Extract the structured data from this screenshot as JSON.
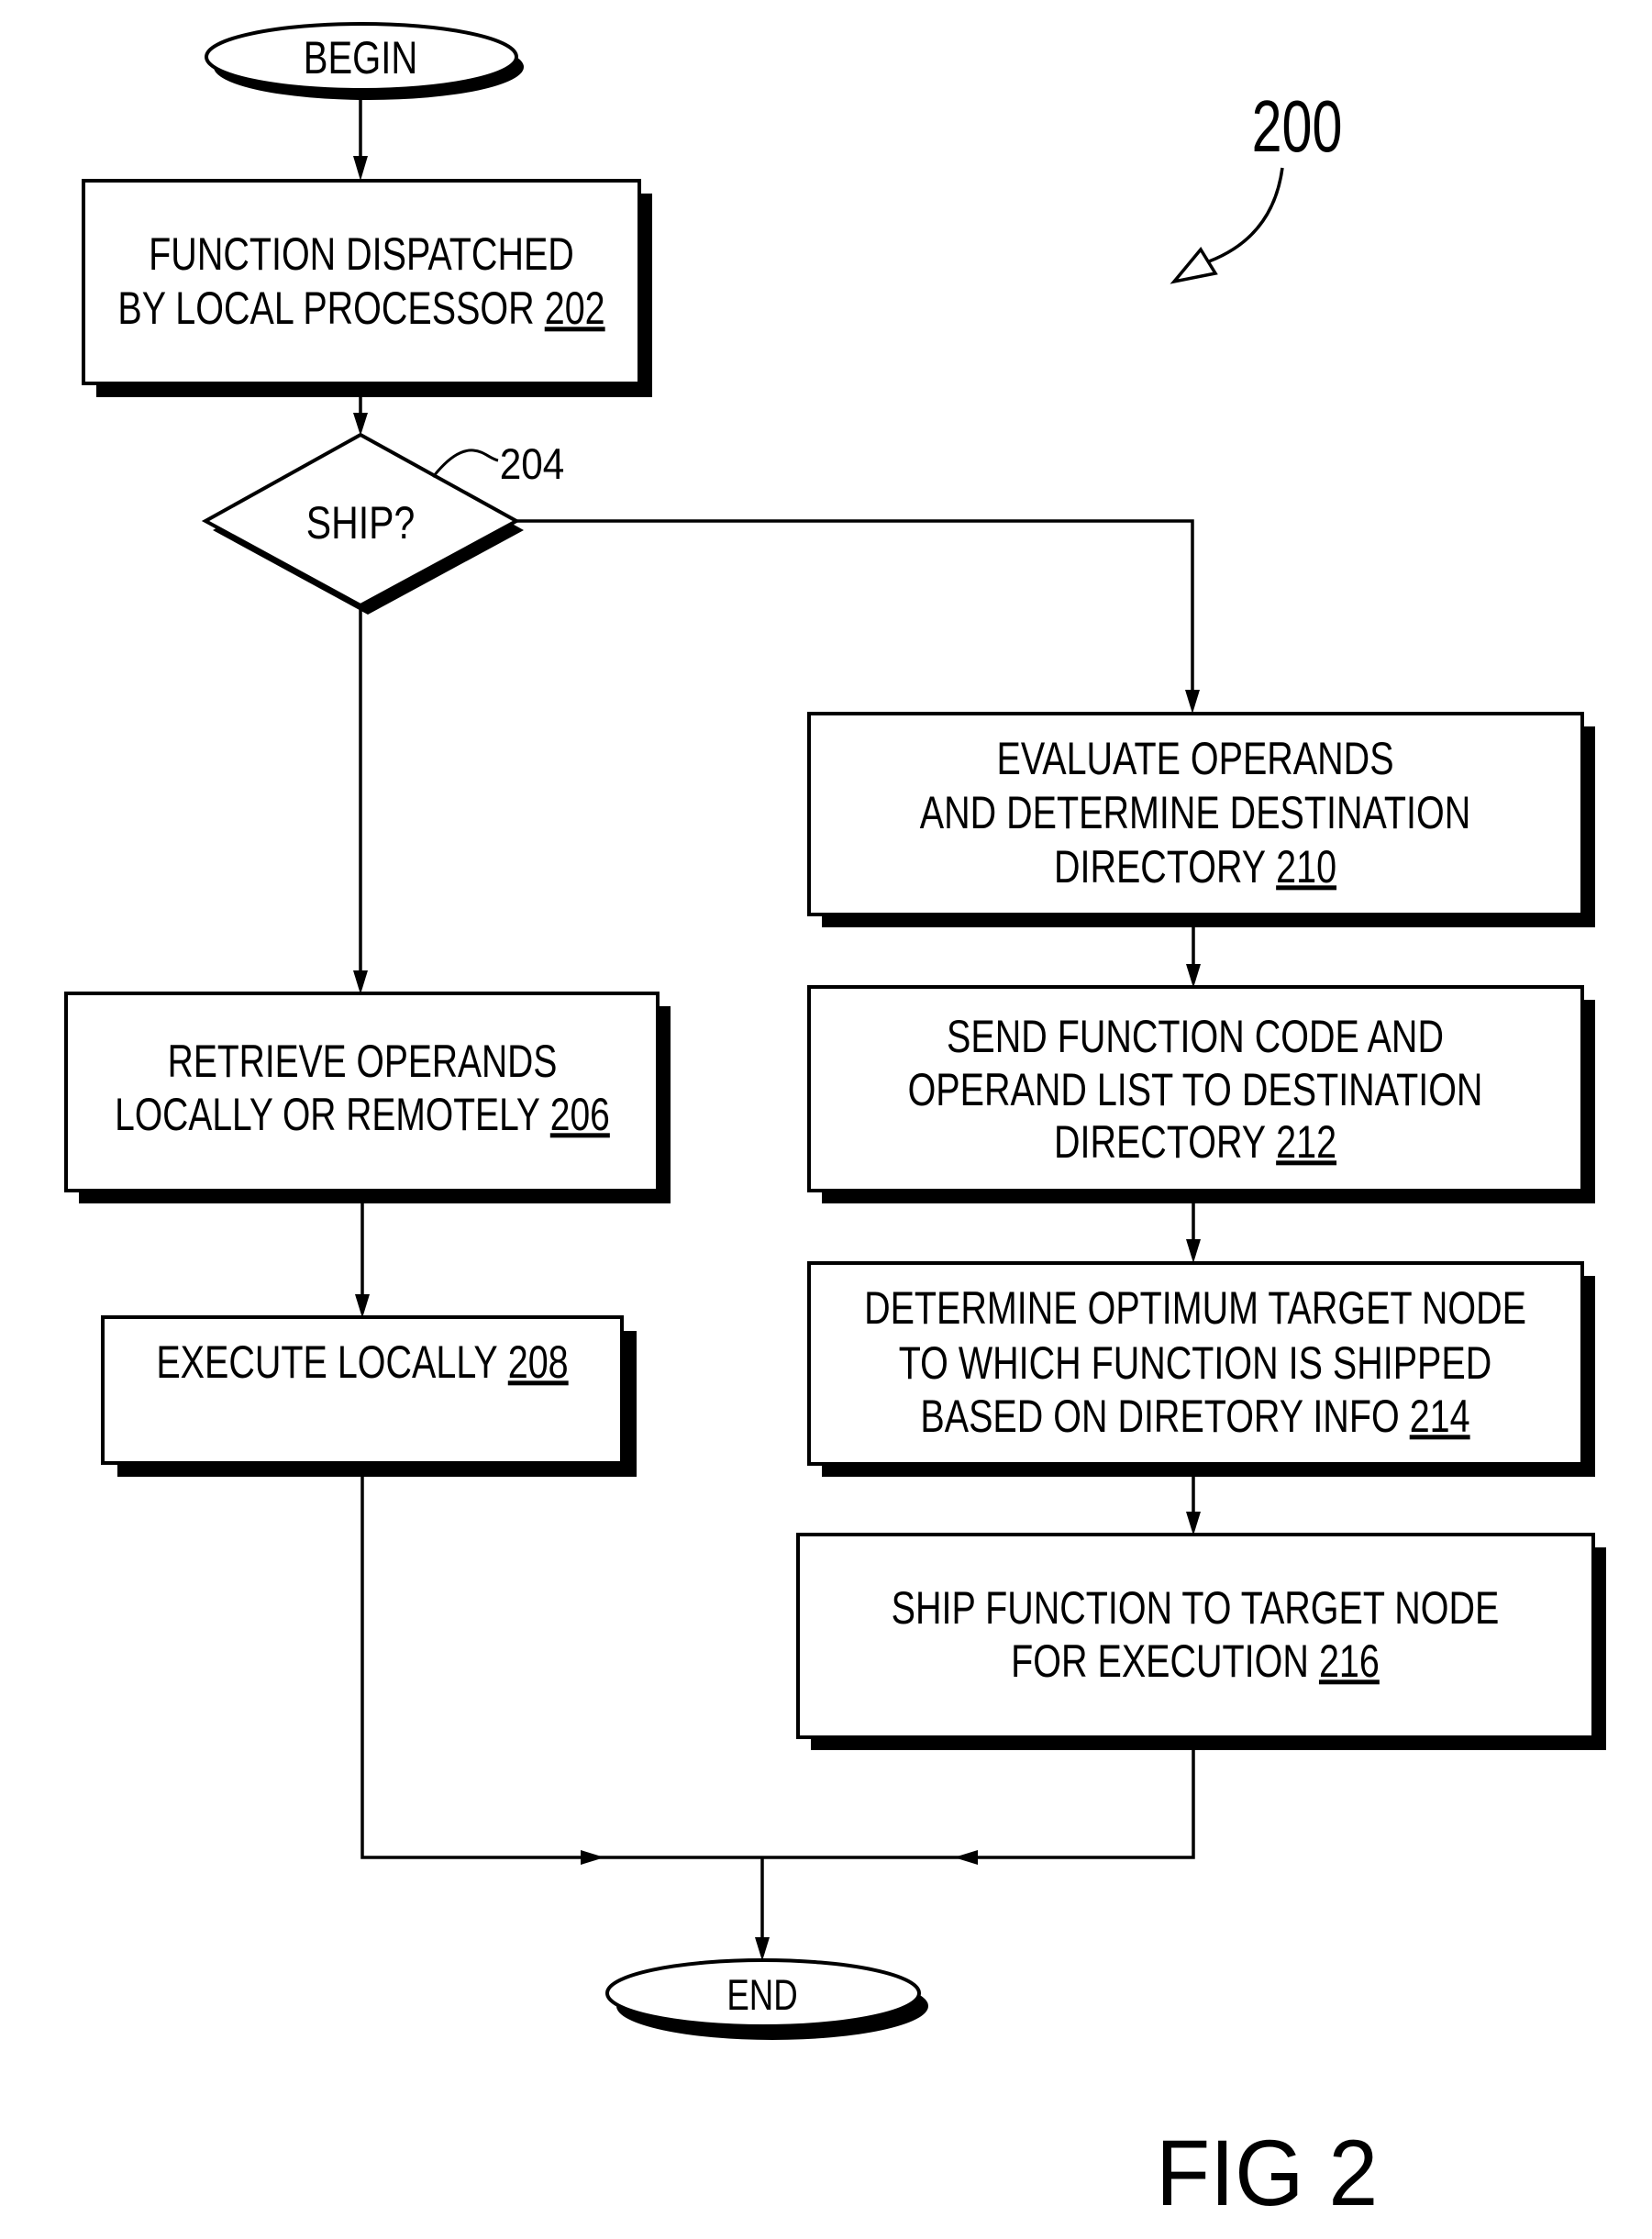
{
  "figure": {
    "reference_number": "200",
    "caption": "FIG 2"
  },
  "terminals": {
    "begin": "BEGIN",
    "end": "END"
  },
  "decision": {
    "label": "SHIP?",
    "ref": "204"
  },
  "steps": [
    {
      "id": "202",
      "lines": [
        "FUNCTION DISPATCHED",
        "BY LOCAL PROCESSOR"
      ],
      "ref": "202"
    },
    {
      "id": "206",
      "lines": [
        "RETRIEVE OPERANDS",
        "LOCALLY OR REMOTELY"
      ],
      "ref": "206"
    },
    {
      "id": "208",
      "lines": [
        "EXECUTE LOCALLY"
      ],
      "ref": "208"
    },
    {
      "id": "210",
      "lines": [
        "EVALUATE OPERANDS",
        "AND DETERMINE DESTINATION",
        "DIRECTORY"
      ],
      "ref": "210"
    },
    {
      "id": "212",
      "lines": [
        "SEND FUNCTION CODE AND",
        "OPERAND LIST TO DESTINATION",
        "DIRECTORY"
      ],
      "ref": "212"
    },
    {
      "id": "214",
      "lines": [
        "DETERMINE OPTIMUM TARGET NODE",
        "TO WHICH FUNCTION IS SHIPPED",
        "BASED ON DIRETORY INFO"
      ],
      "ref": "214"
    },
    {
      "id": "216",
      "lines": [
        "SHIP FUNCTION TO TARGET NODE",
        "FOR EXECUTION"
      ],
      "ref": "216"
    }
  ],
  "colors": {
    "ink": "#000000",
    "paper": "#ffffff"
  }
}
